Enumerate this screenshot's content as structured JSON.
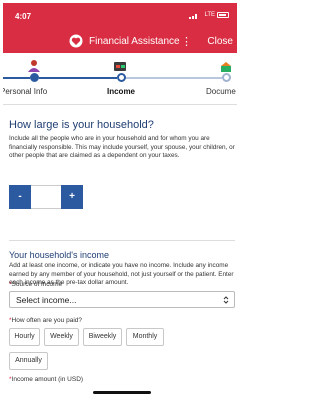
{
  "status": {
    "time": "4:07",
    "network": "LTE"
  },
  "nav": {
    "title": "Financial Assistance",
    "menu": "⋮",
    "close": "Close"
  },
  "steps": [
    {
      "label": "Personal Info",
      "state": "done"
    },
    {
      "label": "Income",
      "state": "active"
    },
    {
      "label": "Docume",
      "state": "todo"
    }
  ],
  "household": {
    "question": "How large is your household?",
    "help": "Include all the people who are in your household and for whom you are financially responsible. This may include yourself, your spouse, your children, or other people that are claimed as a dependent on your taxes.",
    "minus": "-",
    "plus": "+",
    "count": ""
  },
  "income": {
    "heading": "Your household's income",
    "help": "Add at least one income, or indicate you have no income. Include any income earned by any member of your household, not just yourself or the patient. Enter each income as the pre-tax dollar amount.",
    "source": {
      "required": "*",
      "label": "Source of income",
      "placeholder": "Select income..."
    },
    "frequency": {
      "required": "*",
      "label": "How often are you paid?",
      "options": [
        "Hourly",
        "Weekly",
        "Biweekly",
        "Monthly",
        "Annually"
      ]
    },
    "amount": {
      "required": "*",
      "label": "Income amount (in USD)"
    }
  },
  "colors": {
    "brand": "#d92d43",
    "primary": "#2c5aa0",
    "heading": "#1f3e73"
  },
  "icons": [
    "heart-logo-icon",
    "personal-info-icon",
    "income-icon",
    "documents-icon",
    "chevron-updown-icon"
  ]
}
